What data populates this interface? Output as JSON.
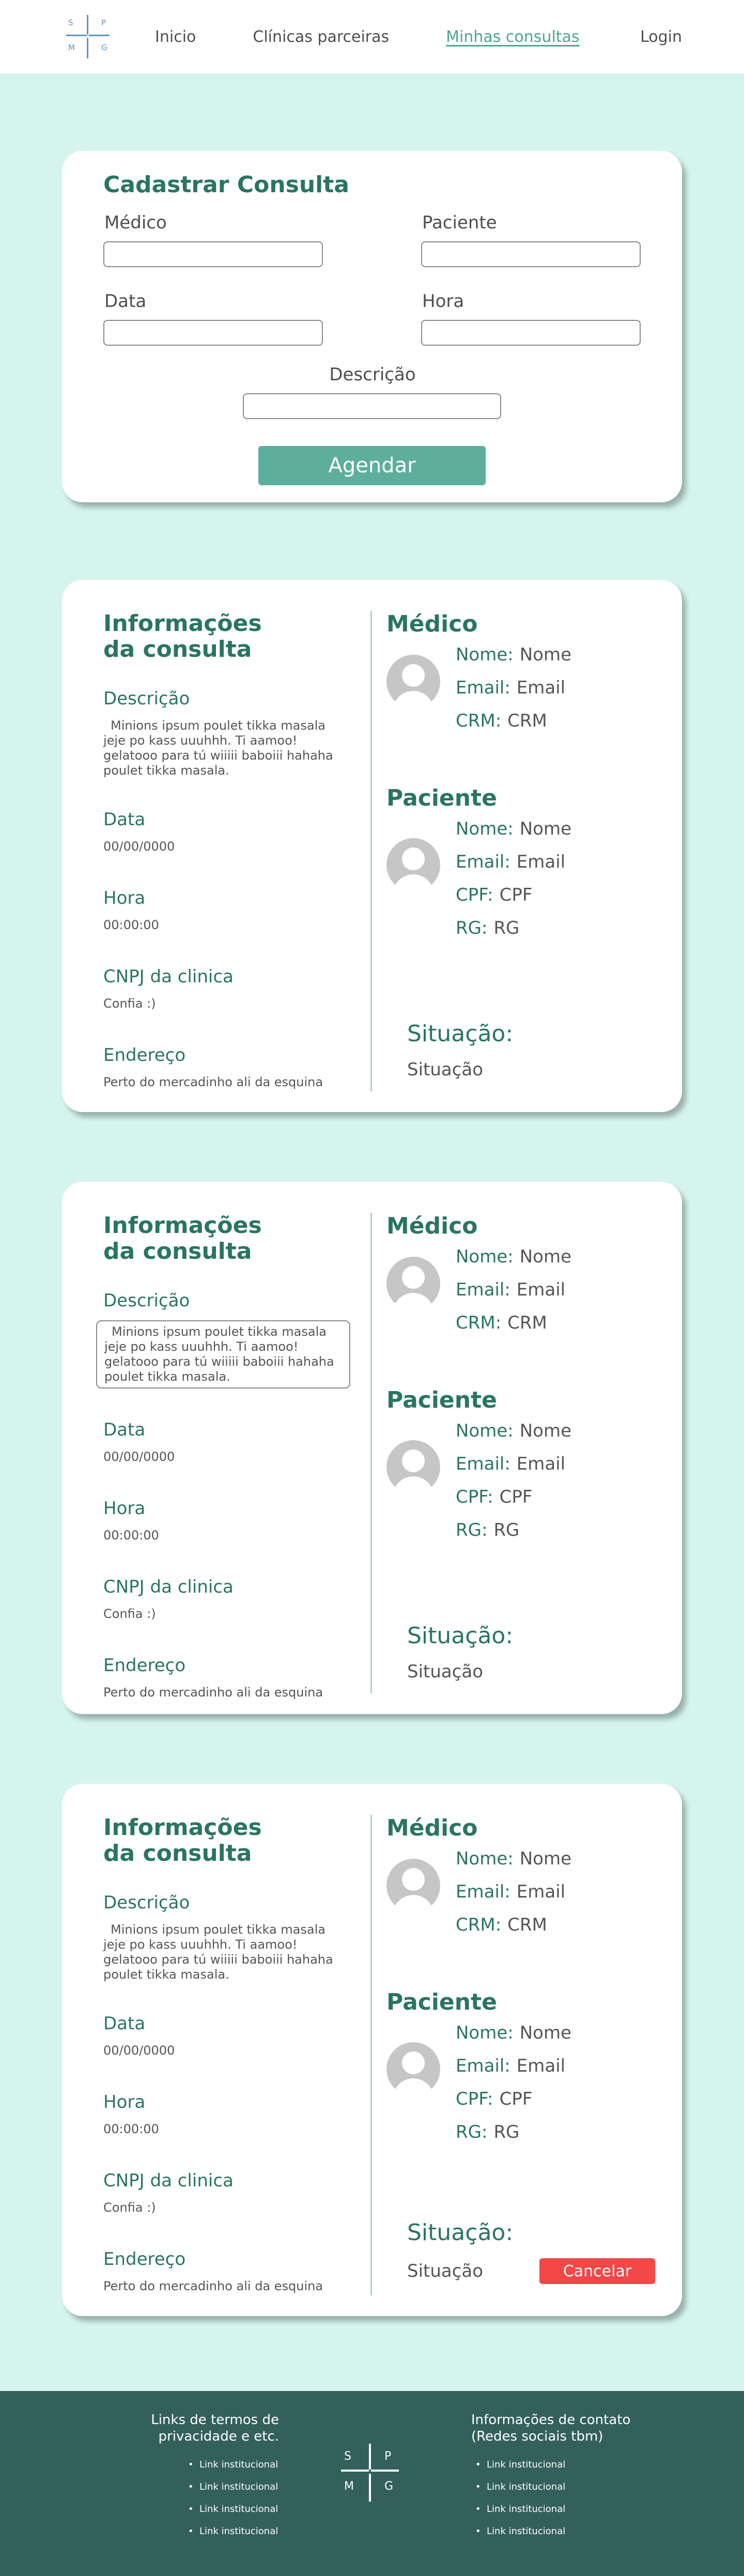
{
  "logo": {
    "letters": [
      "S",
      "P",
      "M",
      "G"
    ]
  },
  "nav": {
    "items": [
      {
        "label": "Inicio"
      },
      {
        "label": "Clínicas parceiras"
      },
      {
        "label": "Minhas consultas"
      },
      {
        "label": "Login"
      }
    ]
  },
  "form": {
    "title": "Cadastrar Consulta",
    "medico_label": "Médico",
    "paciente_label": "Paciente",
    "data_label": "Data",
    "hora_label": "Hora",
    "descricao_label": "Descrição",
    "submit_label": "Agendar"
  },
  "consultas": [
    {
      "info_title_1": "Informações",
      "info_title_2": "da consulta",
      "descricao_label": "Descrição",
      "descricao": "Minions ipsum poulet tikka masala jeje po kass uuuhhh. Ti aamoo! gelatooo para tú wiiiii baboiii hahaha poulet tikka masala.",
      "data_label": "Data",
      "data": "00/00/0000",
      "hora_label": "Hora",
      "hora": "00:00:00",
      "cnpj_label": "CNPJ da clinica",
      "cnpj": "Confia :)",
      "endereco_label": "Endereço",
      "endereco": "Perto do mercadinho ali da esquina",
      "medico_title": "Médico",
      "medico": {
        "nome_k": "Nome:",
        "nome": "Nome",
        "email_k": "Email:",
        "email": "Email",
        "crm_k": "CRM:",
        "crm": "CRM"
      },
      "paciente_title": "Paciente",
      "paciente": {
        "nome_k": "Nome:",
        "nome": "Nome",
        "email_k": "Email:",
        "email": "Email",
        "cpf_k": "CPF:",
        "cpf": "CPF",
        "rg_k": "RG:",
        "rg": "RG"
      },
      "situacao_title": "Situação:",
      "situacao": "Situação"
    },
    {
      "info_title_1": "Informações",
      "info_title_2": "da consulta",
      "descricao_label": "Descrição",
      "descricao": "Minions ipsum poulet tikka masala jeje po kass uuuhhh. Ti aamoo! gelatooo para tú wiiiii baboiii hahaha poulet tikka masala.",
      "data_label": "Data",
      "data": "00/00/0000",
      "hora_label": "Hora",
      "hora": "00:00:00",
      "cnpj_label": "CNPJ da clinica",
      "cnpj": "Confia :)",
      "endereco_label": "Endereço",
      "endereco": "Perto do mercadinho ali da esquina",
      "medico_title": "Médico",
      "medico": {
        "nome_k": "Nome:",
        "nome": "Nome",
        "email_k": "Email:",
        "email": "Email",
        "crm_k": "CRM:",
        "crm": "CRM"
      },
      "paciente_title": "Paciente",
      "paciente": {
        "nome_k": "Nome:",
        "nome": "Nome",
        "email_k": "Email:",
        "email": "Email",
        "cpf_k": "CPF:",
        "cpf": "CPF",
        "rg_k": "RG:",
        "rg": "RG"
      },
      "situacao_title": "Situação:",
      "situacao": "Situação"
    },
    {
      "info_title_1": "Informações",
      "info_title_2": "da consulta",
      "descricao_label": "Descrição",
      "descricao": "Minions ipsum poulet tikka masala jeje po kass uuuhhh. Ti aamoo! gelatooo para tú wiiiii baboiii hahaha poulet tikka masala.",
      "data_label": "Data",
      "data": "00/00/0000",
      "hora_label": "Hora",
      "hora": "00:00:00",
      "cnpj_label": "CNPJ da clinica",
      "cnpj": "Confia :)",
      "endereco_label": "Endereço",
      "endereco": "Perto do mercadinho ali da esquina",
      "medico_title": "Médico",
      "medico": {
        "nome_k": "Nome:",
        "nome": "Nome",
        "email_k": "Email:",
        "email": "Email",
        "crm_k": "CRM:",
        "crm": "CRM"
      },
      "paciente_title": "Paciente",
      "paciente": {
        "nome_k": "Nome:",
        "nome": "Nome",
        "email_k": "Email:",
        "email": "Email",
        "cpf_k": "CPF:",
        "cpf": "CPF",
        "rg_k": "RG:",
        "rg": "RG"
      },
      "situacao_title": "Situação:",
      "situacao": "Situação",
      "cancel_label": "Cancelar"
    }
  ],
  "footer": {
    "left_title_1": "Links de termos de",
    "left_title_2": "privacidade e etc.",
    "left_links": [
      "Link institucional",
      "Link institucional",
      "Link institucional",
      "Link institucional"
    ],
    "right_title_1": "Informações de contato",
    "right_title_2": "(Redes sociais tbm)",
    "right_links": [
      "Link institucional",
      "Link institucional",
      "Link institucional",
      "Link institucional"
    ]
  },
  "colors": {
    "background": "#d5f4ed",
    "accent": "#2a7561",
    "button": "#5daf9b",
    "cancel": "#f24848",
    "footer": "#33605a",
    "logo": "#5d94c9"
  }
}
